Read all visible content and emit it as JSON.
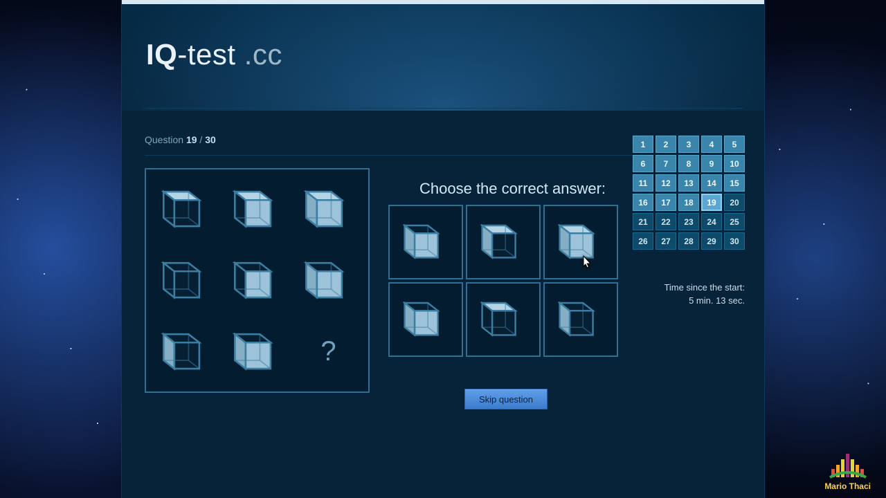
{
  "brand": {
    "bold": "IQ",
    "rest": "-test",
    "dim": " .cc"
  },
  "question": {
    "label": "Question",
    "current": "19",
    "sep": " / ",
    "total": "30"
  },
  "choose_label": "Choose the correct answer:",
  "skip_label": "Skip question",
  "qmark": "?",
  "timer": {
    "label": "Time since the start:",
    "value": "5 min. 13 sec."
  },
  "nav": {
    "total": 30,
    "answered_through": 18,
    "current": 19
  },
  "watermark": "Mario Thaci",
  "puzzle": {
    "grid": [
      {
        "front": false,
        "left": false,
        "top": true
      },
      {
        "front": true,
        "left": false,
        "top": true
      },
      {
        "front": true,
        "left": true,
        "top": true
      },
      {
        "front": false,
        "left": false,
        "top": false
      },
      {
        "front": true,
        "left": false,
        "top": false
      },
      {
        "front": true,
        "left": true,
        "top": false
      },
      {
        "front": false,
        "left": true,
        "top": false
      },
      {
        "front": true,
        "left": true,
        "top": false
      },
      "missing"
    ]
  },
  "answers": [
    {
      "front": true,
      "left": true,
      "top": false
    },
    {
      "front": false,
      "left": true,
      "top": true
    },
    {
      "front": true,
      "left": true,
      "top": true
    },
    {
      "front": true,
      "left": true,
      "top": false
    },
    {
      "front": false,
      "left": false,
      "top": true
    },
    {
      "front": false,
      "left": true,
      "top": false
    }
  ],
  "colors": {
    "fill": "#9cc3d9",
    "dark": "#061f33",
    "stroke": "#3c7ea1",
    "top_shade": "#b4d4e4",
    "side_shade": "#86afc6"
  }
}
